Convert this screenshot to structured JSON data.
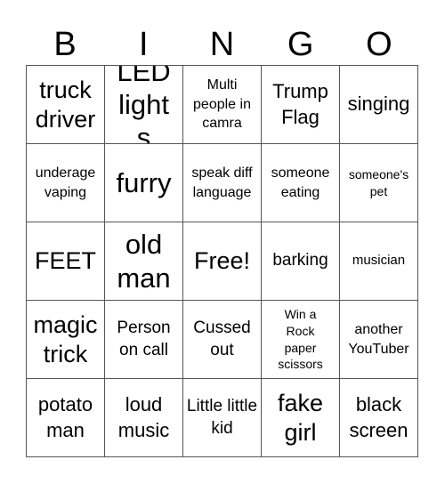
{
  "header": {
    "letters": [
      "B",
      "I",
      "N",
      "G",
      "O"
    ]
  },
  "card": {
    "rows": [
      [
        "truck driver",
        "LED lights",
        "Multi people in camra",
        "Trump Flag",
        "singing"
      ],
      [
        "underage vaping",
        "furry",
        "speak diff language",
        "someone eating",
        "someone's pet"
      ],
      [
        "FEET",
        "old man",
        "Free!",
        "barking",
        "musician"
      ],
      [
        "magic trick",
        "Person on call",
        "Cussed out",
        "Win a Rock paper scissors",
        "another YouTuber"
      ],
      [
        "potato man",
        "loud music",
        "Little little kid",
        "fake girl",
        "black screen"
      ]
    ],
    "free_space": "Free!",
    "border_color": "#555555"
  }
}
